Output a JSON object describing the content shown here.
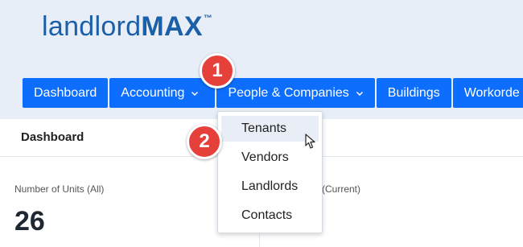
{
  "colors": {
    "header_bg": "#e8eef7",
    "nav_blue": "#0d6efd",
    "logo_blue": "#1a5fa8",
    "badge_red": "#e6403a",
    "active_item_bg": "#e9eef6"
  },
  "logo": {
    "light": "landlord",
    "bold": "MAX",
    "tm": "™"
  },
  "nav": {
    "dashboard": "Dashboard",
    "accounting": "Accounting",
    "people": "People & Companies",
    "buildings": "Buildings",
    "workorders": "Workorde"
  },
  "dropdown": {
    "items": [
      "Tenants",
      "Vendors",
      "Landlords",
      "Contacts"
    ],
    "active": "Tenants"
  },
  "page": {
    "title": "Dashboard"
  },
  "stats": {
    "units_label": "Number of Units (All)",
    "units_value": "26",
    "second_label_partial": "(Current)"
  },
  "badges": {
    "step1": "1",
    "step2": "2"
  },
  "icons": {
    "chevron": "chevron-down-icon",
    "cursor": "mouse-pointer-icon"
  }
}
